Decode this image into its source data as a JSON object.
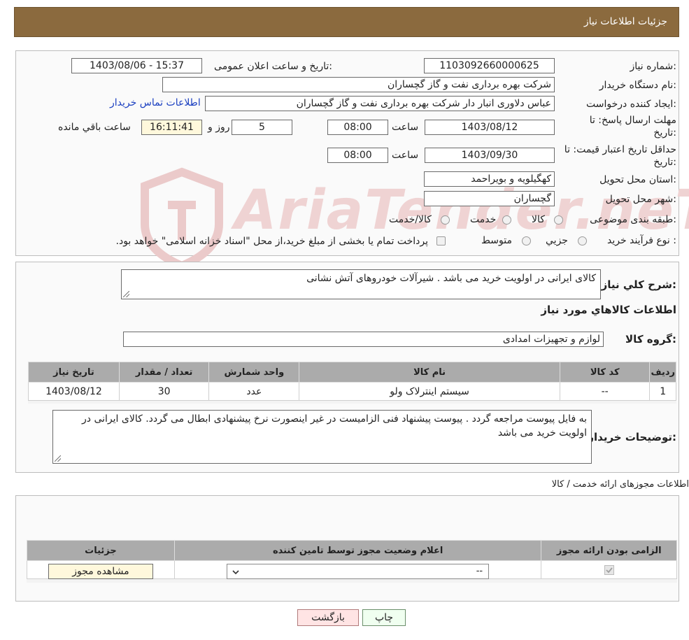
{
  "header": {
    "title": "جزئیات اطلاعات نیاز"
  },
  "fields": {
    "need_number_label": "شماره نیاز:",
    "need_number": "1103092660000625",
    "announce_label": "تاریخ و ساعت اعلان عمومی:",
    "announce_value": "1403/08/06 - 15:37",
    "buyer_label": "نام دستگاه خریدار:",
    "buyer_value": "شرکت بهره برداری نفت و گاز گچساران",
    "creator_label": "ایجاد کننده درخواست:",
    "creator_value": "عباس دلاوری انبار دار شرکت بهره برداری نفت و گاز گچساران",
    "contact_link": "اطلاعات تماس خریدار",
    "deadline_label_1": "مهلت ارسال پاسخ: تا",
    "deadline_label_2": "تاریخ:",
    "deadline_date": "1403/08/12",
    "time_word": "ساعت",
    "deadline_time": "08:00",
    "days_value": "5",
    "days_word": "روز و",
    "remaining_time": "16:11:41",
    "remaining_word": "ساعت باقي مانده",
    "validity_label_1": "حداقل تاریخ اعتبار قیمت: تا",
    "validity_label_2": "تاریخ:",
    "validity_date": "1403/09/30",
    "validity_time": "08:00",
    "province_label": "استان محل تحویل:",
    "province_value": "کهگیلویه و بویراحمد",
    "city_label": "شهر محل تحویل:",
    "city_value": "گچساران",
    "category_label": "طبقه بندی موضوعی:",
    "category_options": [
      "کالا",
      "خدمت",
      "کالا/خدمت"
    ],
    "process_label": "نوع فرآیند خرید :",
    "process_options": [
      "جزیي",
      "متوسط"
    ],
    "process_note": "پرداخت تمام یا بخشی از مبلغ خرید،از محل \"اسناد خزانه اسلامی\" خواهد بود."
  },
  "summary": {
    "description_label": "شرح کلي نياز:",
    "description_value": "کالای ایرانی در اولویت خرید می باشد . شیرآلات خودروهای آتش نشانی",
    "goods_title": "اطلاعات کالاهاي مورد نياز",
    "group_label": "گروه کالا:",
    "group_value": "لوازم و تجهیزات امدادی",
    "table_headers": [
      "رديف",
      "کد کالا",
      "نام کالا",
      "واحد شمارش",
      "تعداد / مقدار",
      "تاریخ نیاز"
    ],
    "table_rows": [
      [
        "1",
        "--",
        "سیستم اینترلاک ولو",
        "عدد",
        "30",
        "1403/08/12"
      ]
    ],
    "buyer_notes_label": "توضیحات خریدار:",
    "buyer_notes_value": "به فایل پیوست مراجعه گردد . پیوست پیشنهاد فنی الزامیست در غیر اینصورت نرخ پیشنهادی ابطال می گردد. کالای ایرانی در اولویت خرید می باشد"
  },
  "permits": {
    "section_title": "اطلاعات مجوزهای ارائه خدمت / کالا",
    "headers": [
      "الزامی بودن ارائه مجوز",
      "اعلام وضعیت مجوز توسط تامین کننده",
      "جزئیات"
    ],
    "select_value": "--",
    "view_button": "مشاهده مجوز"
  },
  "buttons": {
    "print": "چاپ",
    "back": "بازگشت"
  },
  "watermark": "AriaTender.neT",
  "colors": {
    "header_bg": "#8b6a3e",
    "table_header_bg": "#ababab",
    "time_bg": "#fff8dc"
  }
}
